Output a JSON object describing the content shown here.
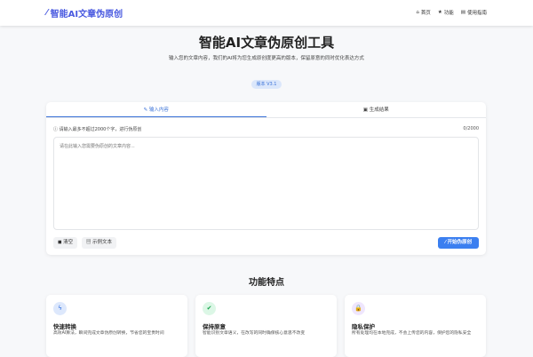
{
  "header": {
    "logo": "智能AI文章伪原创",
    "nav": [
      {
        "icon": "home-icon",
        "glyph": "⌂",
        "label": "首页"
      },
      {
        "icon": "star-icon",
        "glyph": "★",
        "label": "功能"
      },
      {
        "icon": "book-icon",
        "glyph": "▤",
        "label": "使用指南"
      }
    ]
  },
  "hero": {
    "title": "智能AI文章伪原创工具",
    "subtitle": "输入您的文章内容，我们的AI将为您生成原创度更高的版本，保留原意的同时优化表达方式",
    "version": "版本 V3.1"
  },
  "editor": {
    "tabs": [
      {
        "label": "输入内容",
        "glyph": "✎"
      },
      {
        "label": "生成结果",
        "glyph": "▣"
      }
    ],
    "hint": "请输入最多不超过2000个字，进行伪原创",
    "hint_glyph": "ⓘ",
    "counter": "0/2000",
    "placeholder": "请在此输入您需要伪原创的文章内容...",
    "clear": "清空",
    "sample": "示例文本",
    "start": "开始伪原创"
  },
  "features": {
    "title": "功能特点",
    "items": [
      {
        "icon": "lightning-icon",
        "glyph": "ϟ",
        "color": "#2f6fe0",
        "bg": "#dde8fc",
        "title": "快速转换",
        "desc": "高效AI算法，瞬间完成文章伪原创转换，节省您的宝贵时间"
      },
      {
        "icon": "check-circle-icon",
        "glyph": "✔",
        "color": "#16a34a",
        "bg": "#dcf7e6",
        "title": "保持原意",
        "desc": "智能识别文章语义，在改写的同时确保核心意思不改变"
      },
      {
        "icon": "lock-icon",
        "glyph": "🔒",
        "color": "#7c3aed",
        "bg": "#efe6fd",
        "title": "隐私保护",
        "desc": "所有处理均在本地完成，不会上传您的内容，保护您的隐私安全"
      }
    ]
  }
}
